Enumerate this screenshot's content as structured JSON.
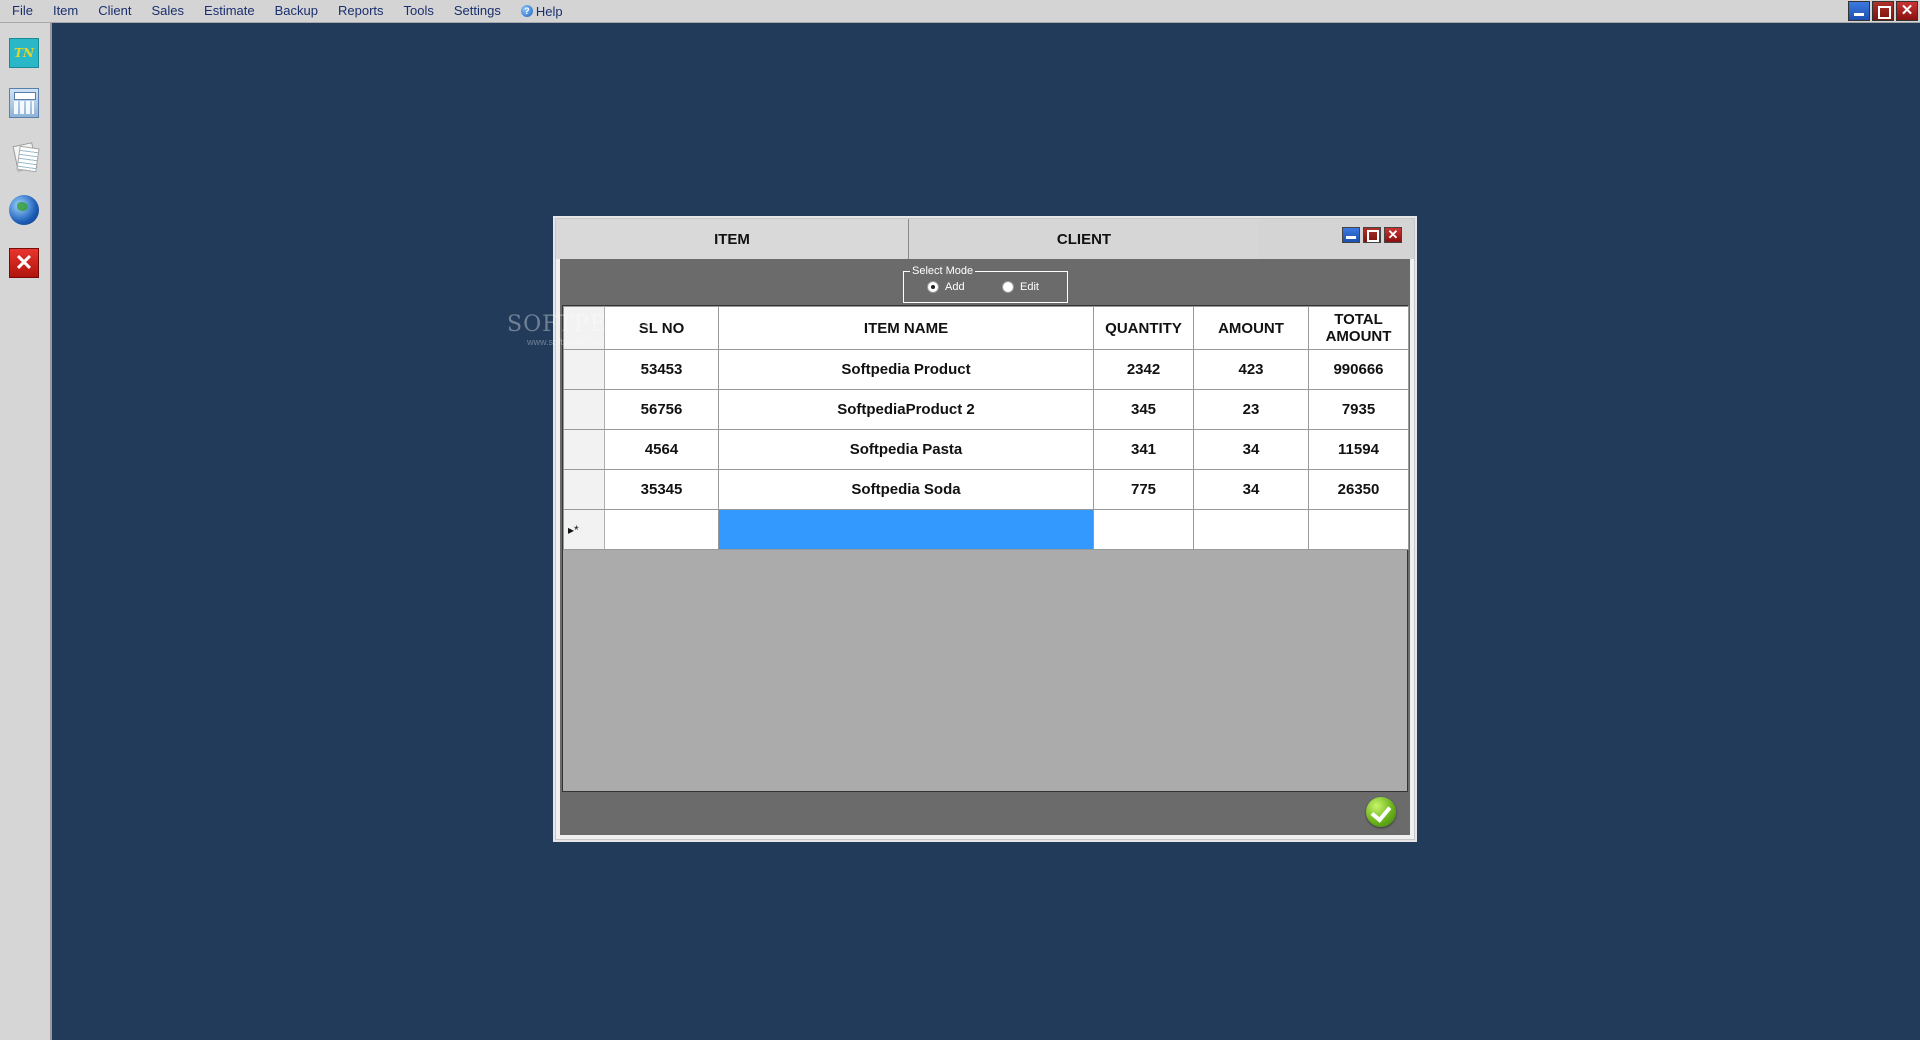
{
  "menu": [
    "File",
    "Item",
    "Client",
    "Sales",
    "Estimate",
    "Backup",
    "Reports",
    "Tools",
    "Settings"
  ],
  "help_label": "Help",
  "sidebar": {
    "logo_text": "TN"
  },
  "dialog": {
    "tabs": [
      "ITEM",
      "CLIENT"
    ],
    "mode": {
      "legend": "Select Mode",
      "add": "Add",
      "edit": "Edit",
      "selected": "Add"
    },
    "columns": [
      "SL NO",
      "ITEM NAME",
      "QUANTITY",
      "AMOUNT",
      "TOTAL AMOUNT"
    ],
    "rows": [
      [
        "53453",
        "Softpedia Product",
        "2342",
        "423",
        "990666"
      ],
      [
        "56756",
        "SoftpediaProduct 2",
        "345",
        "23",
        "7935"
      ],
      [
        "4564",
        "Softpedia Pasta",
        "341",
        "34",
        "11594"
      ],
      [
        "35345",
        "Softpedia Soda",
        "775",
        "34",
        "26350"
      ]
    ],
    "new_row_marker": "▸*"
  },
  "watermark": {
    "text": "SOFTPEDIA",
    "url": "www.softpedia.com"
  },
  "colors": {
    "desktop": "#223b5b",
    "selection": "#3399ff",
    "panel": "#6b6b6b"
  }
}
